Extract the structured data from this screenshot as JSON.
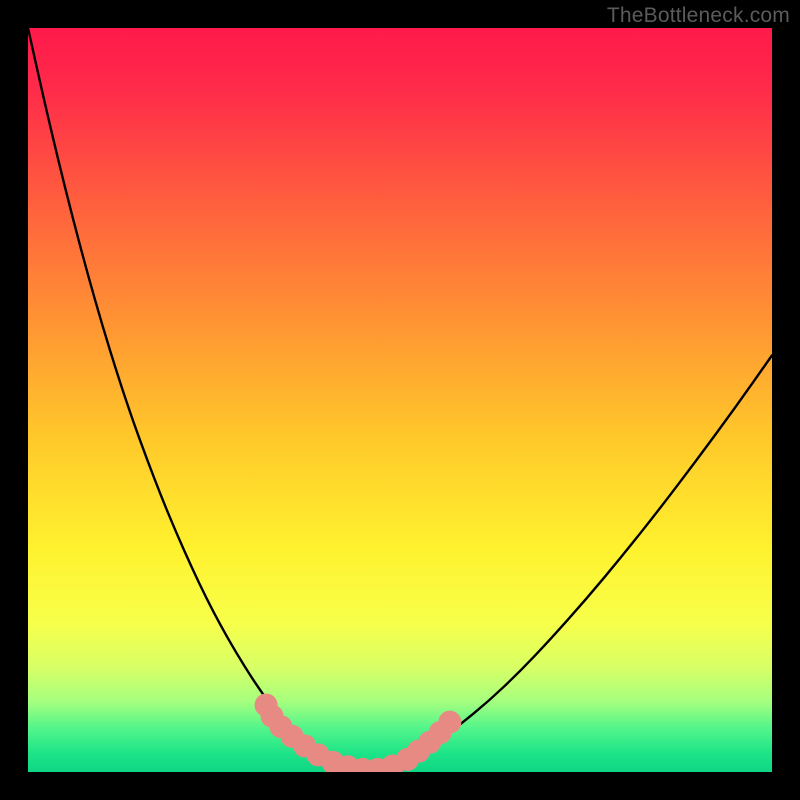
{
  "watermark": "TheBottleneck.com",
  "colors": {
    "frame": "#000000",
    "gradient_stops": [
      {
        "offset": 0.0,
        "color": "#ff1a4b"
      },
      {
        "offset": 0.08,
        "color": "#ff2a4a"
      },
      {
        "offset": 0.22,
        "color": "#ff5a3f"
      },
      {
        "offset": 0.38,
        "color": "#ff8f34"
      },
      {
        "offset": 0.55,
        "color": "#ffc82a"
      },
      {
        "offset": 0.7,
        "color": "#fff22e"
      },
      {
        "offset": 0.8,
        "color": "#f7ff4a"
      },
      {
        "offset": 0.86,
        "color": "#d7ff66"
      },
      {
        "offset": 0.905,
        "color": "#a6ff7e"
      },
      {
        "offset": 0.94,
        "color": "#55f58a"
      },
      {
        "offset": 0.975,
        "color": "#1de488"
      },
      {
        "offset": 1.0,
        "color": "#0fd684"
      }
    ],
    "curve": "#000000",
    "markers": "#e88a84"
  },
  "chart_data": {
    "type": "line",
    "title": "",
    "xlabel": "",
    "ylabel": "",
    "xlim": [
      0,
      100
    ],
    "ylim": [
      0,
      100
    ],
    "x": [
      0,
      2,
      4,
      6,
      8,
      10,
      12,
      14,
      16,
      18,
      20,
      22,
      24,
      26,
      28,
      30,
      31,
      32,
      33,
      34,
      35,
      36,
      37,
      38,
      39,
      40,
      41,
      42,
      43,
      44,
      46,
      48,
      50,
      52,
      55,
      58,
      62,
      66,
      70,
      75,
      80,
      85,
      90,
      95,
      100
    ],
    "y": [
      100,
      91,
      82.5,
      74.5,
      67,
      60,
      53.5,
      47.5,
      42,
      36.8,
      32,
      27.5,
      23.3,
      19.5,
      16,
      12.8,
      11.3,
      9.9,
      8.6,
      7.4,
      6.3,
      5.3,
      4.4,
      3.6,
      2.9,
      2.3,
      1.8,
      1.3,
      0.9,
      0.6,
      0.35,
      0.6,
      1.3,
      2.3,
      4.1,
      6.3,
      9.6,
      13.4,
      17.6,
      23.2,
      29.2,
      35.5,
      42.1,
      48.9,
      56
    ],
    "markers": [
      {
        "x": 32.0,
        "y": 9.0
      },
      {
        "x": 32.8,
        "y": 7.5
      },
      {
        "x": 34.0,
        "y": 6.1
      },
      {
        "x": 35.5,
        "y": 4.8
      },
      {
        "x": 37.2,
        "y": 3.5
      },
      {
        "x": 39.0,
        "y": 2.3
      },
      {
        "x": 41.0,
        "y": 1.3
      },
      {
        "x": 43.0,
        "y": 0.7
      },
      {
        "x": 45.0,
        "y": 0.35
      },
      {
        "x": 47.0,
        "y": 0.35
      },
      {
        "x": 49.0,
        "y": 0.8
      },
      {
        "x": 51.0,
        "y": 1.7
      },
      {
        "x": 52.5,
        "y": 2.8
      },
      {
        "x": 54.0,
        "y": 4.0
      },
      {
        "x": 55.4,
        "y": 5.3
      },
      {
        "x": 56.7,
        "y": 6.7
      }
    ],
    "marker_radius_pct": 1.55,
    "note": "x and y are percentages of the plot area (0–100); y=0 at bottom, y=100 at top. Curve represents a bottleneck metric (lower is better) vs. an unlabeled x-axis; minimum near x≈45."
  }
}
